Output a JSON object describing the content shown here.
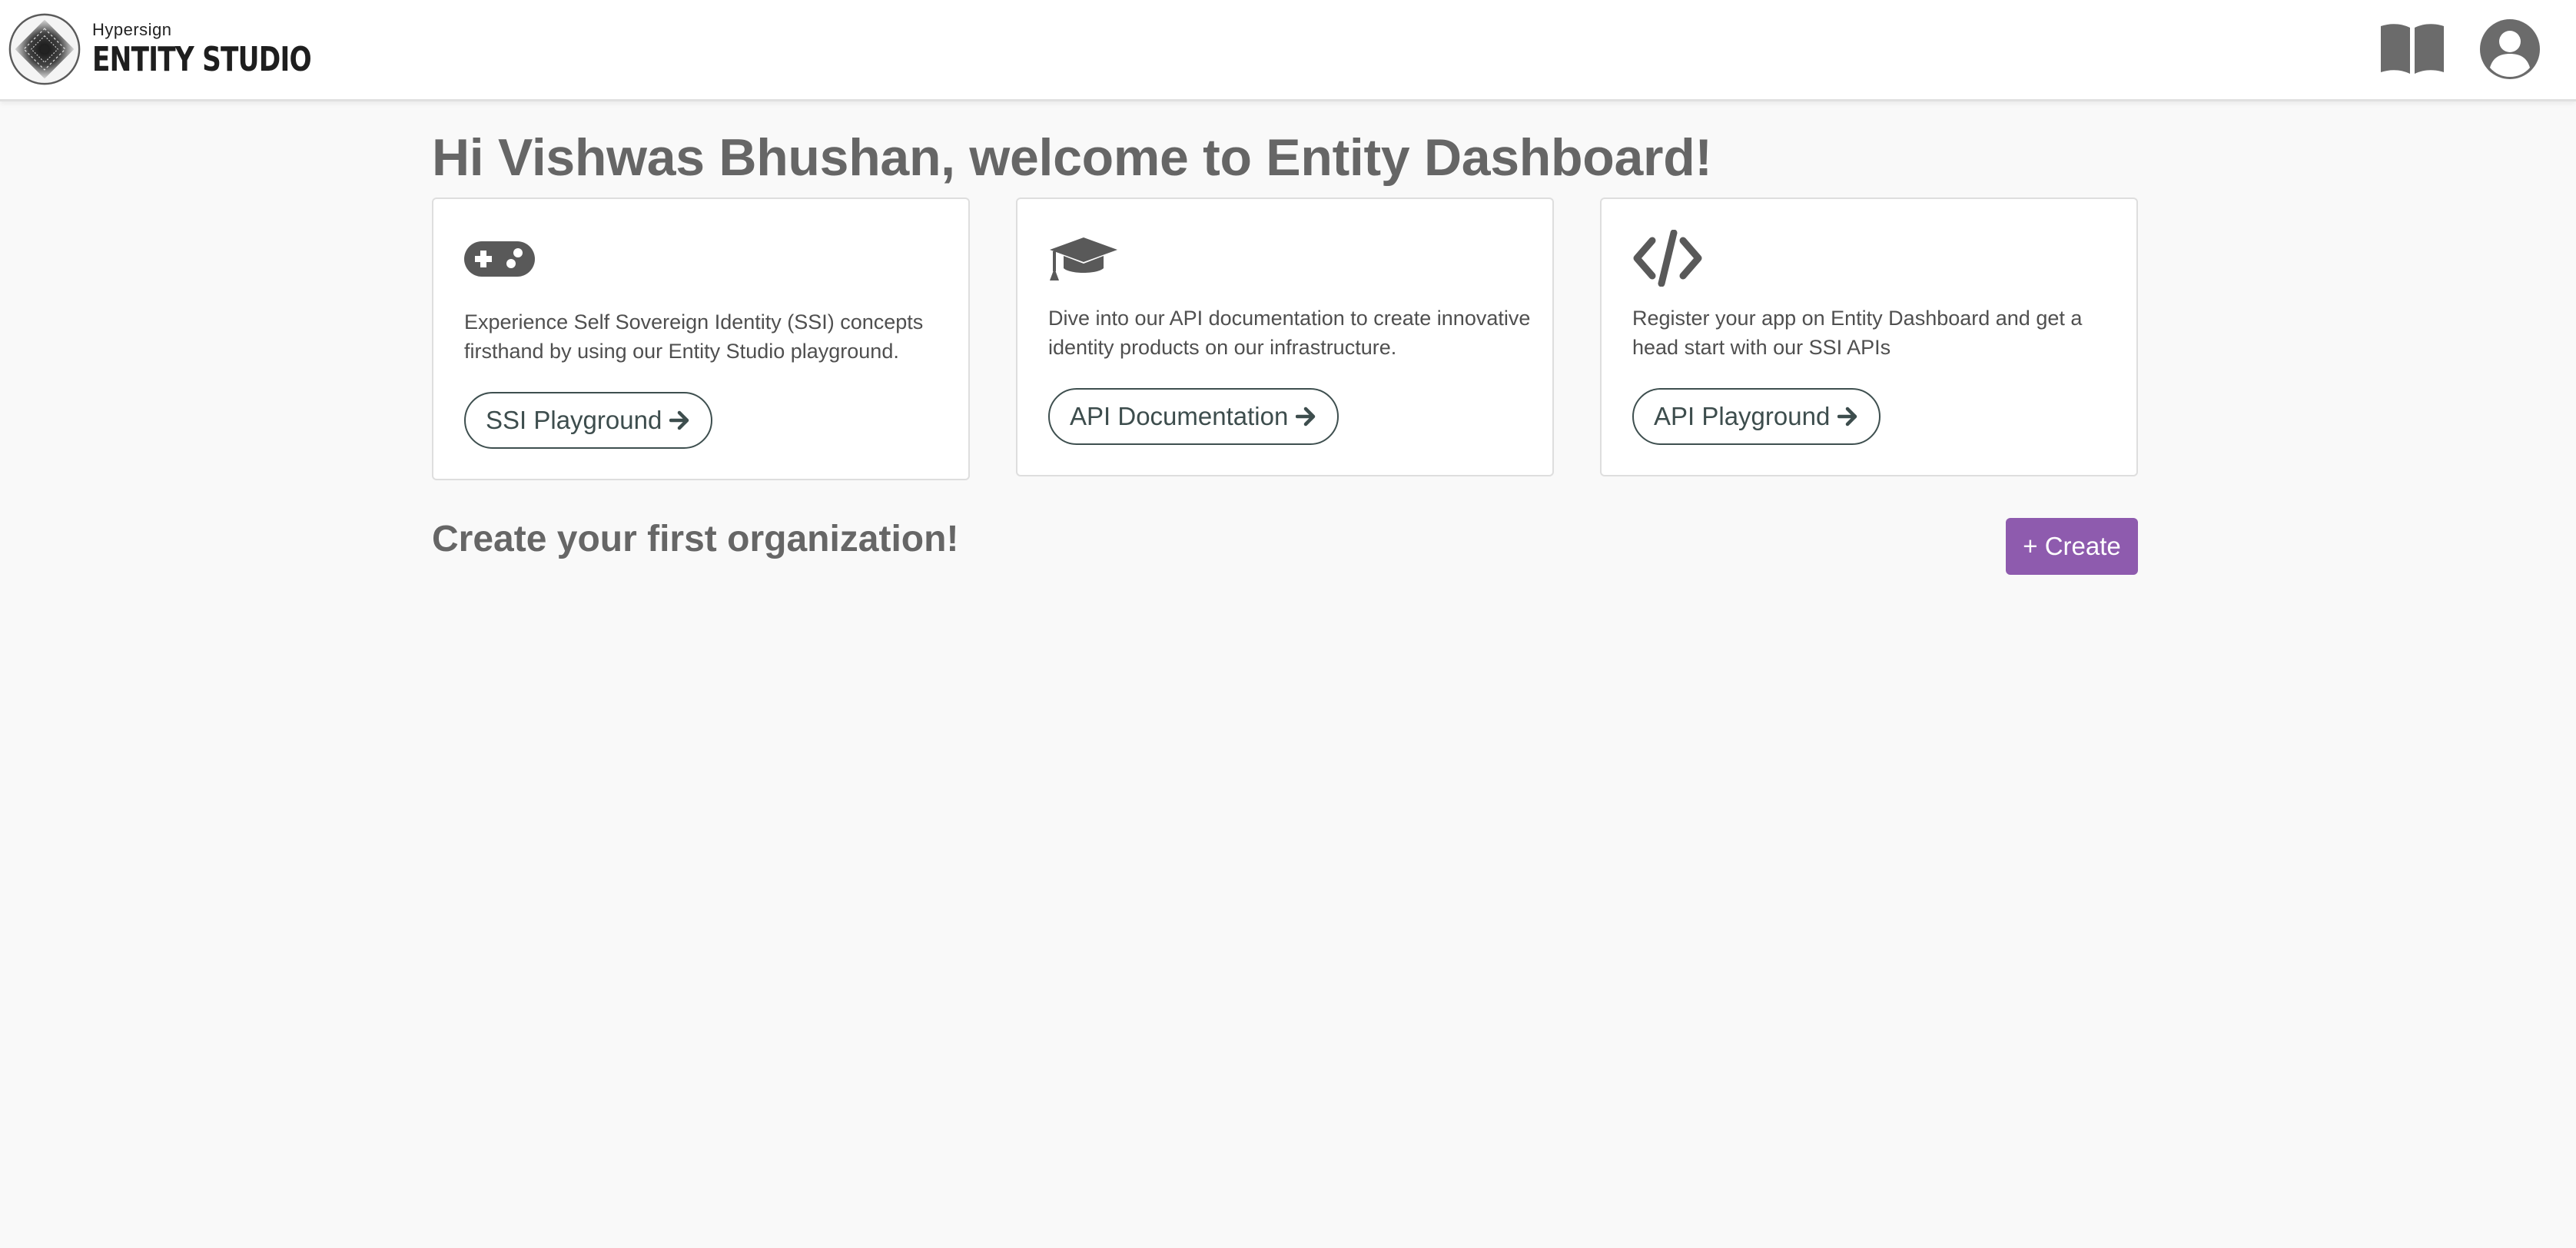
{
  "navbar": {
    "brand_sub": "Hypersign",
    "brand_main": "ENTITY STUDIO",
    "icons": [
      "book-icon",
      "user-circle-icon"
    ]
  },
  "welcome": {
    "title": "Hi Vishwas Bhushan, welcome to Entity Dashboard!"
  },
  "cards": [
    {
      "icon": "gamepad-icon",
      "text": "Experience Self Sovereign Identity (SSI) concepts firsthand by using our Entity Studio playground.",
      "button_label": "SSI Playground"
    },
    {
      "icon": "graduation-cap-icon",
      "text": "Dive into our API documentation to create innovative identity products on our infrastructure.",
      "button_label": "API Documentation"
    },
    {
      "icon": "code-icon",
      "text": "Register your app on Entity Dashboard and get a head start with our SSI APIs",
      "button_label": "API Playground"
    }
  ],
  "organization": {
    "heading": "Create your first organization!",
    "create_label": "+ Create"
  },
  "colors": {
    "accent": "#8e5bae",
    "text": "#4f4f4f",
    "heading": "#666666",
    "background": "#f9f9f9",
    "pill_border": "#3e4f4f"
  }
}
